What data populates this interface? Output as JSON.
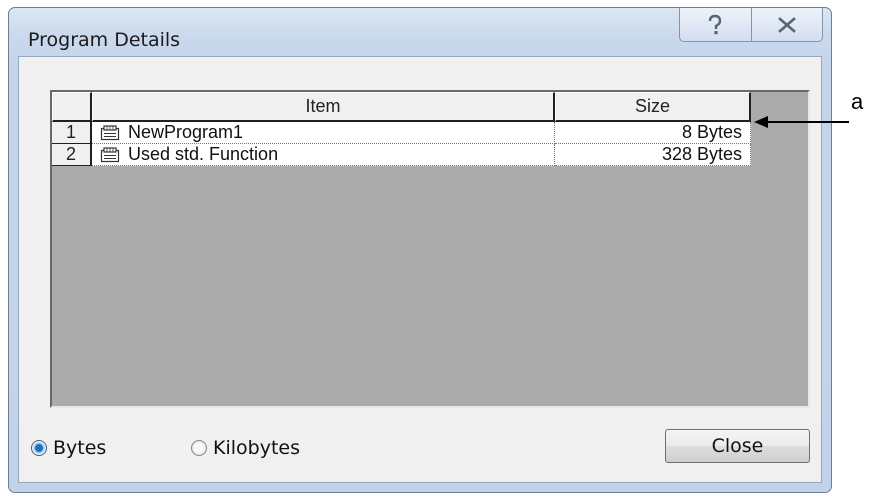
{
  "window": {
    "title": "Program Details",
    "help_icon": "question-mark-icon",
    "close_icon": "close-x-icon"
  },
  "grid": {
    "columns": [
      "",
      "Item",
      "Size"
    ],
    "rows": [
      {
        "index": "1",
        "icon": "program-icon",
        "item": "NewProgram1",
        "size": "8 Bytes"
      },
      {
        "index": "2",
        "icon": "program-icon",
        "item": "Used std. Function",
        "size": "328 Bytes"
      }
    ]
  },
  "units": {
    "options": [
      "Bytes",
      "Kilobytes"
    ],
    "selected": "Bytes"
  },
  "buttons": {
    "close_label": "Close"
  },
  "annotation": {
    "label": "a"
  },
  "colors": {
    "accent": "#1e6fbf",
    "frame": "#c1d3ea"
  }
}
